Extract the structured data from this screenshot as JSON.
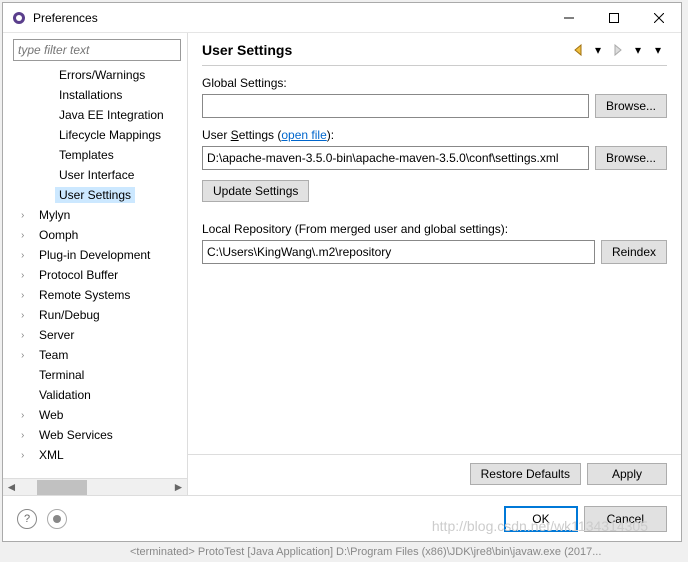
{
  "window": {
    "title": "Preferences"
  },
  "filter": {
    "placeholder": "type filter text"
  },
  "tree": {
    "children": [
      {
        "label": "Errors/Warnings"
      },
      {
        "label": "Installations"
      },
      {
        "label": "Java EE Integration"
      },
      {
        "label": "Lifecycle Mappings"
      },
      {
        "label": "Templates"
      },
      {
        "label": "User Interface"
      },
      {
        "label": "User Settings",
        "selected": true
      }
    ],
    "tops": [
      {
        "label": "Mylyn",
        "expandable": true
      },
      {
        "label": "Oomph",
        "expandable": true
      },
      {
        "label": "Plug-in Development",
        "expandable": true
      },
      {
        "label": "Protocol Buffer",
        "expandable": true
      },
      {
        "label": "Remote Systems",
        "expandable": true
      },
      {
        "label": "Run/Debug",
        "expandable": true
      },
      {
        "label": "Server",
        "expandable": true
      },
      {
        "label": "Team",
        "expandable": true
      },
      {
        "label": "Terminal",
        "expandable": false
      },
      {
        "label": "Validation",
        "expandable": false
      },
      {
        "label": "Web",
        "expandable": true
      },
      {
        "label": "Web Services",
        "expandable": true
      },
      {
        "label": "XML",
        "expandable": true
      }
    ]
  },
  "page": {
    "title": "User Settings",
    "global_label": "Global Settings:",
    "global_value": "",
    "browse1": "Browse...",
    "user_label_pre": "User ",
    "user_label_u": "S",
    "user_label_post": "ettings (",
    "open_file": "open file",
    "user_label_end": "):",
    "user_value": "D:\\apache-maven-3.5.0-bin\\apache-maven-3.5.0\\conf\\settings.xml",
    "browse2": "Browse...",
    "update": "Update Settings",
    "repo_label": "Local Repository (From merged user and global settings):",
    "repo_value": "C:\\Users\\KingWang\\.m2\\repository",
    "reindex_pre": "Re",
    "reindex_u": "i",
    "reindex_post": "ndex",
    "restore_pre": "Restore ",
    "restore_u": "D",
    "restore_post": "efaults",
    "apply_u": "A",
    "apply_post": "pply"
  },
  "footer": {
    "ok": "OK",
    "cancel": "Cancel"
  },
  "watermark": "http://blog.csdn.net/wk1134314305",
  "status": "<terminated> ProtoTest [Java Application] D:\\Program Files (x86)\\JDK\\jre8\\bin\\javaw.exe (2017..."
}
